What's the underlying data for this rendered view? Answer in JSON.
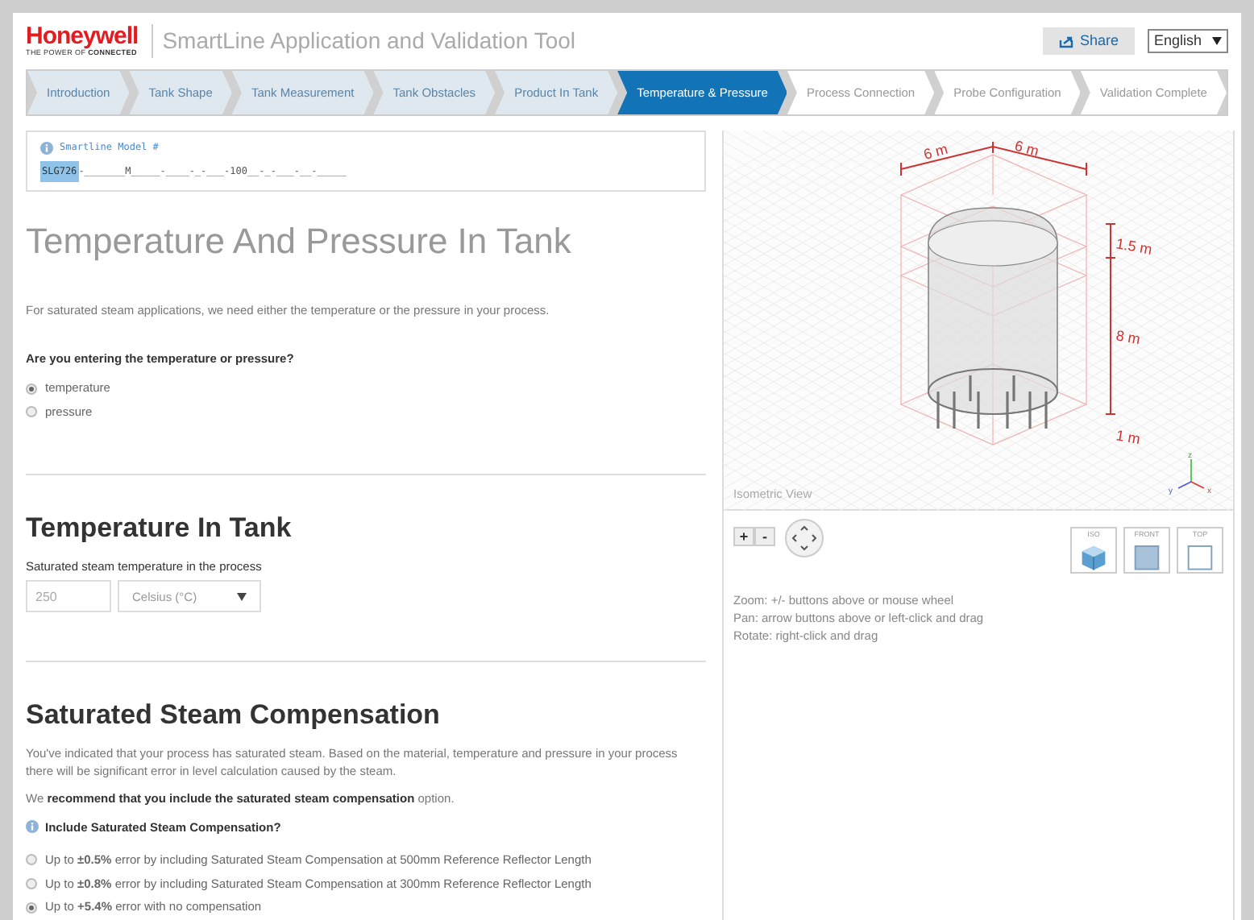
{
  "header": {
    "brand": "Honeywell",
    "tagline_prefix": "THE POWER OF ",
    "tagline_bold": "CONNECTED",
    "title": "SmartLine Application and Validation Tool",
    "share": "Share",
    "language": "English"
  },
  "steps": [
    {
      "label": "Introduction",
      "completed": true,
      "selected": false
    },
    {
      "label": "Tank Shape",
      "completed": true,
      "selected": false
    },
    {
      "label": "Tank Measurement",
      "completed": true,
      "selected": false
    },
    {
      "label": "Tank Obstacles",
      "completed": true,
      "selected": false
    },
    {
      "label": "Product In Tank",
      "completed": true,
      "selected": false
    },
    {
      "label": "Temperature & Pressure",
      "completed": false,
      "selected": true
    },
    {
      "label": "Process Connection",
      "completed": false,
      "selected": false
    },
    {
      "label": "Probe Configuration",
      "completed": false,
      "selected": false
    },
    {
      "label": "Validation Complete",
      "completed": false,
      "selected": false
    }
  ],
  "model": {
    "label": "Smartline Model #",
    "code": "SLG726",
    "rest": "-_______M_____-____-_-___-100__-_-___-__-_____"
  },
  "page_title": "Temperature And Pressure In Tank",
  "intro": "For saturated steam applications, we need either the temperature or the pressure in your process.",
  "question": "Are you entering the temperature or pressure?",
  "entry_options": [
    {
      "label": "temperature",
      "selected": true
    },
    {
      "label": "pressure",
      "selected": false
    }
  ],
  "temperature": {
    "heading": "Temperature In Tank",
    "label": "Saturated steam temperature in the process",
    "value": "250",
    "unit": "Celsius (°C)"
  },
  "compensation": {
    "heading": "Saturated Steam Compensation",
    "text": "You've indicated that your process has saturated steam. Based on the material, temperature and pressure in your process there will be significant error in level calculation caused by the steam.",
    "recommend": "We **recommend that you include the saturated steam compensation** option.",
    "question": "Include Saturated Steam Compensation?",
    "options": [
      {
        "label": "Up to **±0.5%** error by including Saturated Steam Compensation at 500mm Reference Reflector Length",
        "selected": false
      },
      {
        "label": "Up to **±0.8%** error by including Saturated Steam Compensation at 300mm Reference Reflector Length",
        "selected": false
      },
      {
        "label": "Up to **+5.4%** error with no compensation",
        "selected": true
      }
    ]
  },
  "viewer": {
    "dims": {
      "width": "6 m",
      "depth": "6 m",
      "top": "1.5 m",
      "height": "8 m",
      "bottom": "1 m"
    },
    "axes": {
      "z": "z",
      "y": "y",
      "x": "x"
    },
    "view_name": "Isometric View",
    "zoom_in": "+",
    "zoom_out": "-",
    "views": [
      {
        "label": "ISO",
        "kind": "iso"
      },
      {
        "label": "FRONT",
        "kind": "front"
      },
      {
        "label": "TOP",
        "kind": "top"
      }
    ],
    "help": [
      "Zoom: +/- buttons above or mouse wheel",
      "Pan: arrow buttons above or left-click and drag",
      "Rotate: right-click and drag"
    ]
  }
}
